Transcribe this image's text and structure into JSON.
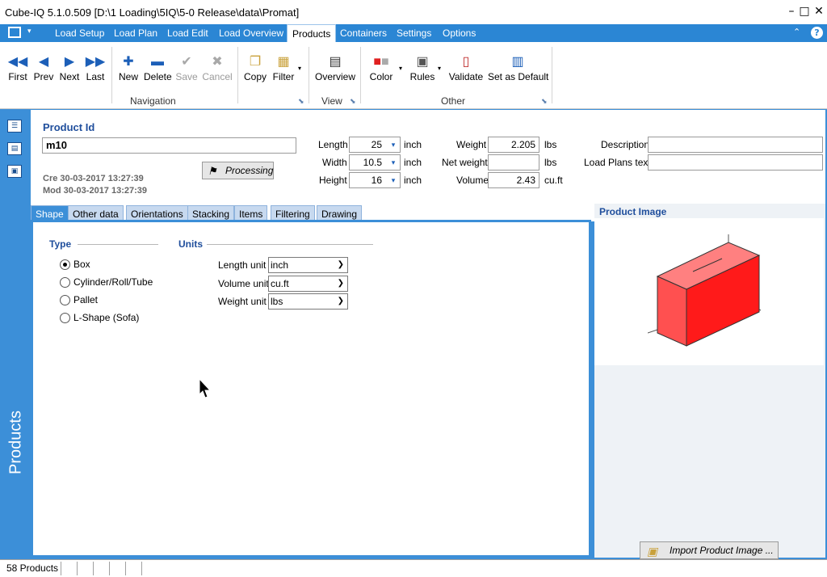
{
  "window": {
    "title": "Cube-IQ  5.1.0.509  [D:\\1 Loading\\5IQ\\5-0  Release\\data\\Promat]",
    "minimize": "–",
    "maximize": "□",
    "close": "✕"
  },
  "ribbon_tabs": [
    "Load Setup",
    "Load Plan",
    "Load Edit",
    "Load Overview",
    "Products",
    "Containers",
    "Settings",
    "Options"
  ],
  "ribbon": {
    "navigation": {
      "label": "Navigation",
      "buttons": [
        "First",
        "Prev",
        "Next",
        "Last",
        "New",
        "Delete",
        "Save",
        "Cancel",
        "Copy",
        "Filter"
      ]
    },
    "view": {
      "label": "View",
      "buttons": [
        "Overview"
      ]
    },
    "other": {
      "label": "Other",
      "buttons": [
        "Color",
        "Rules",
        "Validate",
        "Set as Default"
      ]
    }
  },
  "sidebar": {
    "label": "Products"
  },
  "product": {
    "id_label": "Product Id",
    "id_value": "m10",
    "created": "Cre 30-03-2017 13:27:39",
    "modified": "Mod 30-03-2017 13:27:39",
    "processing": "Processing",
    "length": {
      "label": "Length",
      "value": "25",
      "unit": "inch"
    },
    "width": {
      "label": "Width",
      "value": "10.5",
      "unit": "inch"
    },
    "height": {
      "label": "Height",
      "value": "16",
      "unit": "inch"
    },
    "weight": {
      "label": "Weight",
      "value": "2.205",
      "unit": "lbs"
    },
    "net_weight": {
      "label": "Net weight",
      "value": "",
      "unit": "lbs"
    },
    "volume": {
      "label": "Volume",
      "value": "2.43",
      "unit": "cu.ft"
    },
    "description": {
      "label": "Description",
      "value": ""
    },
    "load_plans_text": {
      "label": "Load Plans text",
      "value": ""
    }
  },
  "content_tabs": [
    "Shape",
    "Other data",
    "Orientations",
    "Stacking",
    "Items",
    "Filtering",
    "Drawing"
  ],
  "shape": {
    "type_label": "Type",
    "types": [
      "Box",
      "Cylinder/Roll/Tube",
      "Pallet",
      "L-Shape (Sofa)"
    ],
    "selected_type": "Box",
    "units_label": "Units",
    "length_unit": {
      "label": "Length unit",
      "value": "inch"
    },
    "volume_unit": {
      "label": "Volume unit",
      "value": "cu.ft"
    },
    "weight_unit": {
      "label": "Weight unit",
      "value": "lbs"
    }
  },
  "image_panel": {
    "title": "Product Image",
    "import_button": "Import Product Image ...",
    "box_color": "#ff3030"
  },
  "status": {
    "count": "58 Products"
  }
}
